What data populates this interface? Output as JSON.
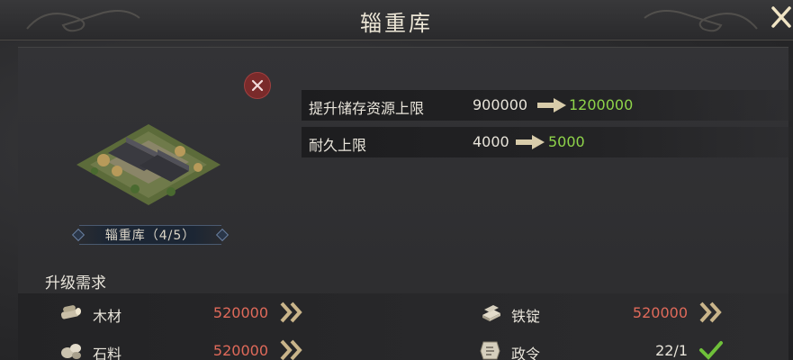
{
  "header": {
    "title": "辎重库"
  },
  "building": {
    "name_plate": "辎重库（4/5）"
  },
  "stats": [
    {
      "label": "提升储存资源上限",
      "old": "900000",
      "new": "1200000"
    },
    {
      "label": "耐久上限",
      "old": "4000",
      "new": "5000"
    }
  ],
  "requirements": {
    "title": "升级需求",
    "items": [
      {
        "name": "木材",
        "value": "520000",
        "status": "insufficient",
        "icon": "wood-icon"
      },
      {
        "name": "铁锭",
        "value": "520000",
        "status": "insufficient",
        "icon": "iron-ingot-icon"
      },
      {
        "name": "石料",
        "value": "520000",
        "status": "insufficient",
        "icon": "stone-icon"
      },
      {
        "name": "政令",
        "value": "22/1",
        "status": "met",
        "icon": "decree-icon"
      }
    ]
  },
  "colors": {
    "upgrade_value": "#8fd44a",
    "insufficient": "#e06a5a",
    "check": "#6fc03a"
  }
}
